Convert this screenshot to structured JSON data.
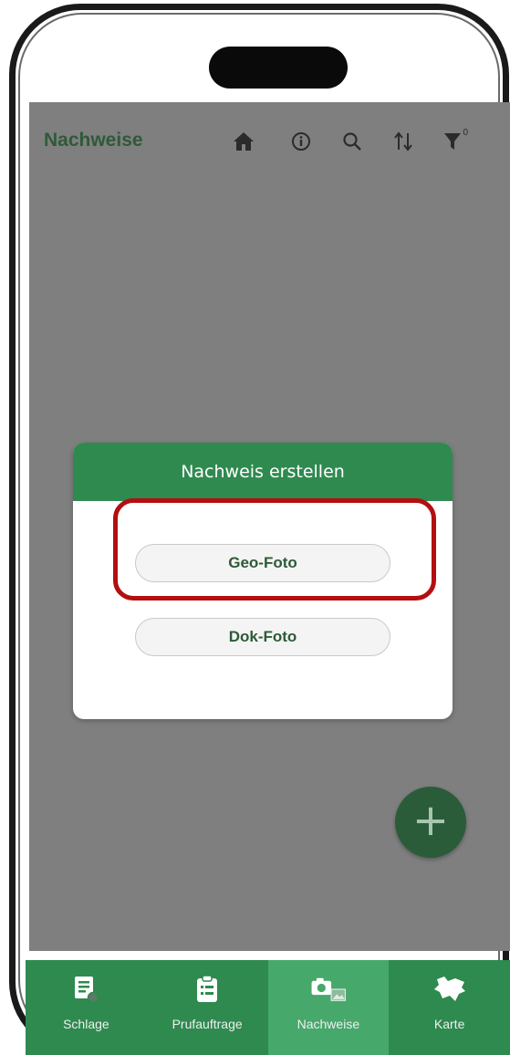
{
  "header": {
    "title": "Nachweise",
    "icons": [
      "home-icon",
      "info-icon",
      "search-icon",
      "sort-icon",
      "filter-icon"
    ],
    "filter_count": "0"
  },
  "dialog": {
    "title": "Nachweis erstellen",
    "options": [
      {
        "label": "Geo-Foto"
      },
      {
        "label": "Dok-Foto"
      }
    ]
  },
  "fab": {
    "symbol": "+"
  },
  "tabbar": {
    "tabs": [
      {
        "label": "Schlage",
        "icon": "fields-icon",
        "active": false
      },
      {
        "label": "Prufauftrage",
        "icon": "clipboard-icon",
        "active": false
      },
      {
        "label": "Nachweise",
        "icon": "camera-gallery-icon",
        "active": true
      },
      {
        "label": "Karte",
        "icon": "map-region-icon",
        "active": false
      }
    ]
  },
  "colors": {
    "brand_green": "#2e8a4e",
    "dialog_header": "#2f8a4f",
    "overlay_gray": "#7f7f7f",
    "highlight_red": "#b30f0f",
    "fab": "#2a5c3a"
  }
}
